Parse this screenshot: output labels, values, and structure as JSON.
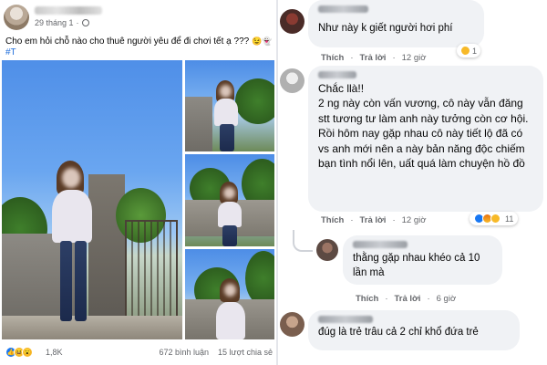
{
  "post": {
    "date": "29 tháng 1",
    "privacy_icon": "globe-icon",
    "text": "Cho em hỏi chỗ nào cho thuê người yêu để đi chơi tết ạ ???",
    "text_emoji": "😉👻",
    "hashtag": "#T",
    "reactions": {
      "icons": [
        "like-icon",
        "haha-icon",
        "wow-icon"
      ],
      "count": "1,8K"
    },
    "comments_count": "672 bình luận",
    "shares_count": "15 lượt chia sẻ"
  },
  "comments": [
    {
      "text": "Như này k giết người hơi phí",
      "like_label": "Thích",
      "reply_label": "Trả lời",
      "time": "12 giờ",
      "reaction_count": "1",
      "reaction_icon": "sad-icon"
    },
    {
      "text_line1": "Chắc llà!!",
      "text_body": "2 ng này còn vấn vương, cô này vẫn đăng stt tương tư làm anh này tưởng còn cơ hội. Rồi hôm nay gặp nhau cô này tiết lộ đã có vs anh mới nên a này bản năng độc chiếm bạn tình nổi lên, uất quá làm chuyện hồ đồ",
      "like_label": "Thích",
      "reply_label": "Trả lời",
      "time": "12 giờ",
      "reaction_count": "11",
      "reaction_icons": [
        "like-icon",
        "angry-icon",
        "haha-icon"
      ]
    },
    {
      "text": "thằng gặp nhau khéo cả 10 lần mà",
      "like_label": "Thích",
      "reply_label": "Trả lời",
      "time": "6 giờ"
    },
    {
      "text": "đúg là trẻ trâu cả 2 chỉ khổ đứa trẻ"
    }
  ]
}
